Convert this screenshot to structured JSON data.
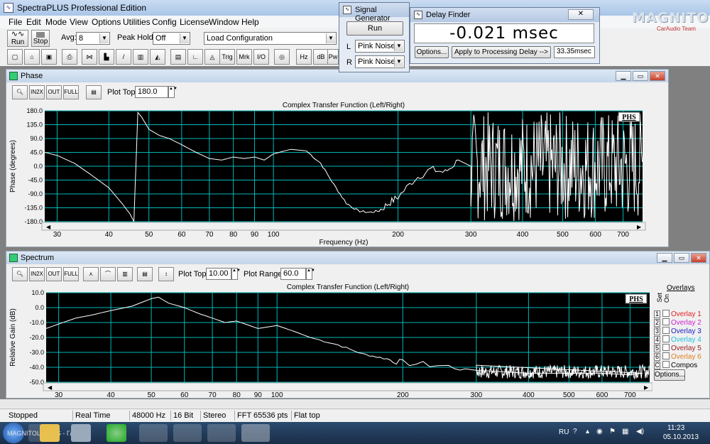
{
  "app": {
    "title": "SpectraPLUS Professional Edition",
    "menu": [
      "File",
      "Edit",
      "Mode",
      "View",
      "Options",
      "Utilities",
      "Config",
      "License",
      "Window",
      "Help"
    ],
    "run_label": "Run",
    "stop_label": "Stop",
    "avg_label": "Avg:",
    "avg_value": "8",
    "peakhold_label": "Peak Hold:",
    "peakhold_value": "Off",
    "loadcfg_value": "Load Configuration",
    "toolbar2": [
      "Trig",
      "Mrk",
      "I/O",
      "Hz",
      "dB",
      "Pw"
    ]
  },
  "signal_generator": {
    "title": "Signal Generator",
    "run_label": "Run",
    "l_label": "L",
    "l_value": "Pink Noise",
    "r_label": "R",
    "r_value": "Pink Noise"
  },
  "delay_finder": {
    "title": "Delay Finder",
    "value": "-0.021 msec",
    "options_label": "Options...",
    "apply_label": "Apply to Processing Delay -->",
    "processing_value": "33.35msec"
  },
  "brand": {
    "main": "MAGNITOLA",
    "sub": "CarAudio Team"
  },
  "phase": {
    "window_title": "Phase",
    "plot_top_label": "Plot Top:",
    "plot_top_value": "180.0",
    "badge": "PHS",
    "chart_title": "Complex Transfer Function (Left/Right)"
  },
  "spectrum": {
    "window_title": "Spectrum",
    "plot_top_label": "Plot Top:",
    "plot_top_value": "10.00",
    "plot_range_label": "Plot Range:",
    "plot_range_value": "60.0",
    "badge": "PHS",
    "chart_title": "Complex Transfer Function (Left/Right)",
    "overlays_header": "Overlays",
    "set_label": "Set",
    "on_label": "On",
    "overlays": [
      {
        "num": "1",
        "name": "Overlay 1",
        "color": "#e02020"
      },
      {
        "num": "2",
        "name": "Overlay 2",
        "color": "#d020d0"
      },
      {
        "num": "3",
        "name": "Overlay 3",
        "color": "#2020c0"
      },
      {
        "num": "4",
        "name": "Overlay 4",
        "color": "#20c0e0"
      },
      {
        "num": "5",
        "name": "Overlay 5",
        "color": "#a02020"
      },
      {
        "num": "6",
        "name": "Overlay 6",
        "color": "#e08020"
      },
      {
        "num": "C",
        "name": "Compos",
        "color": "#000000"
      }
    ],
    "options_label": "Options..."
  },
  "chart_data": [
    {
      "type": "line",
      "title": "Complex Transfer Function (Left/Right)",
      "xlabel": "Frequency (Hz)",
      "ylabel": "Phase (degrees)",
      "x_scale": "log",
      "x_ticks": [
        30,
        40,
        50,
        60,
        70,
        80,
        90,
        100,
        200,
        300,
        400,
        500,
        600,
        700
      ],
      "y_ticks": [
        180.0,
        135.0,
        90.0,
        45.0,
        0.0,
        -45.0,
        -90.0,
        -135.0,
        -180.0
      ],
      "ylim": [
        -180,
        180
      ],
      "grid": true,
      "series": [
        {
          "x": [
            28,
            30,
            33,
            36,
            40,
            43,
            45,
            46,
            47,
            48,
            50,
            53,
            56,
            60,
            65,
            70,
            75,
            80,
            85,
            90,
            95,
            100,
            110,
            120,
            130,
            140,
            150,
            160,
            170,
            180,
            190,
            200,
            220,
            240,
            260,
            280,
            300
          ],
          "y": [
            45,
            35,
            10,
            -25,
            -70,
            -120,
            -155,
            -180,
            175,
            160,
            120,
            100,
            90,
            70,
            45,
            25,
            20,
            30,
            25,
            30,
            20,
            40,
            55,
            50,
            10,
            -60,
            -120,
            -145,
            -150,
            -145,
            -120,
            -100,
            -40,
            -10,
            -20,
            20,
            0
          ]
        }
      ]
    },
    {
      "type": "line",
      "title": "Complex Transfer Function (Left/Right)",
      "xlabel": "",
      "ylabel": "Relative Gain (dB)",
      "x_scale": "log",
      "x_ticks": [
        30,
        40,
        50,
        60,
        70,
        80,
        90,
        100,
        200,
        300,
        400,
        500,
        600,
        700
      ],
      "y_ticks": [
        10.0,
        0.0,
        -10.0,
        -20.0,
        -30.0,
        -40.0,
        -50.0
      ],
      "ylim": [
        -50,
        10
      ],
      "grid": true,
      "series": [
        {
          "x": [
            28,
            30,
            33,
            36,
            40,
            45,
            50,
            52,
            55,
            60,
            65,
            70,
            75,
            80,
            90,
            100,
            110,
            120,
            140,
            160,
            180,
            200,
            250,
            300,
            400,
            500,
            600,
            700,
            750
          ],
          "y": [
            -14,
            -11,
            -7,
            -5,
            -2,
            1,
            6,
            7,
            3,
            0,
            -4,
            -7,
            -10,
            -9,
            -14,
            -12,
            -16,
            -20,
            -25,
            -31,
            -34,
            -37,
            -39,
            -42,
            -44,
            -44,
            -44,
            -45,
            -44
          ]
        }
      ]
    }
  ],
  "status": [
    "Stopped",
    "Real Time",
    "48000 Hz",
    "16 Bit",
    "Stereo",
    "FFT 65536 pts",
    "Flat top"
  ],
  "tray": {
    "lang": "RU",
    "time": "11:23",
    "date": "05.10.2013"
  },
  "taskbar": {
    "item_label": "MAGNITOLA.ORG - Главная"
  }
}
